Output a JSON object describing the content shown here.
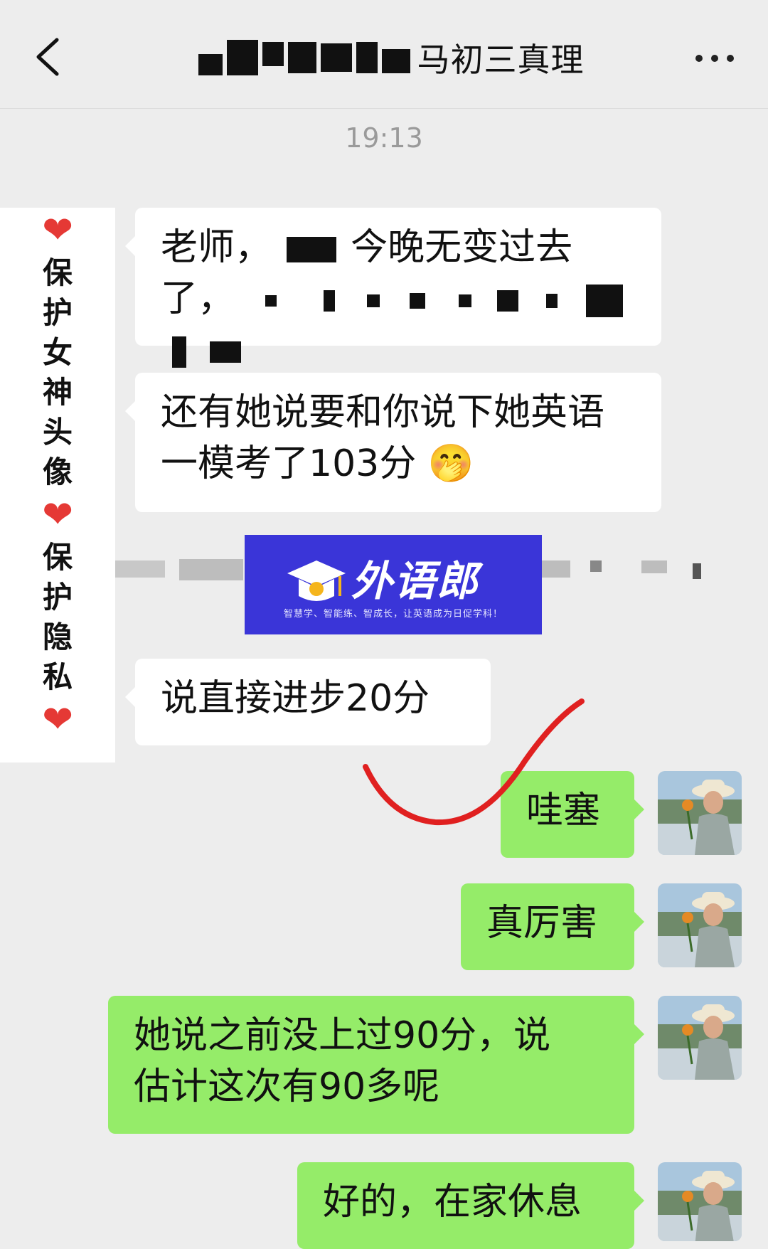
{
  "header": {
    "title_suffix": "马初三真理",
    "back_icon": "chevron-left-icon",
    "more_icon": "ellipsis-icon"
  },
  "timestamp": "19:13",
  "watermark": {
    "chars": [
      "保",
      "护",
      "女",
      "神",
      "头",
      "像",
      "保",
      "护",
      "隐",
      "私"
    ],
    "heart_color": "#e53935"
  },
  "messages": [
    {
      "side": "in",
      "line1": "老师，",
      "line1b": "今晚无变过去",
      "line2": "了，"
    },
    {
      "side": "in",
      "line1": "还有她说要和你说下她英语",
      "line2": "一模考了103分",
      "emoji": "🤭"
    },
    {
      "side": "in",
      "text": "说直接进步20分"
    },
    {
      "side": "out",
      "text": "哇塞"
    },
    {
      "side": "out",
      "text": "真厉害"
    },
    {
      "side": "out",
      "line1": "她说之前没上过90分，说",
      "line2": "估计这次有90多呢"
    },
    {
      "side": "out",
      "text": "好的，在家休息"
    }
  ],
  "banner": {
    "title": "外语郎",
    "tagline": "智慧学、智能练、智成长，让英语成为日促学科！",
    "bg": "#3a35d8"
  },
  "colors": {
    "outgoing": "#95ec69",
    "incoming": "#ffffff",
    "background": "#ededed",
    "annotation": "#e02020"
  }
}
